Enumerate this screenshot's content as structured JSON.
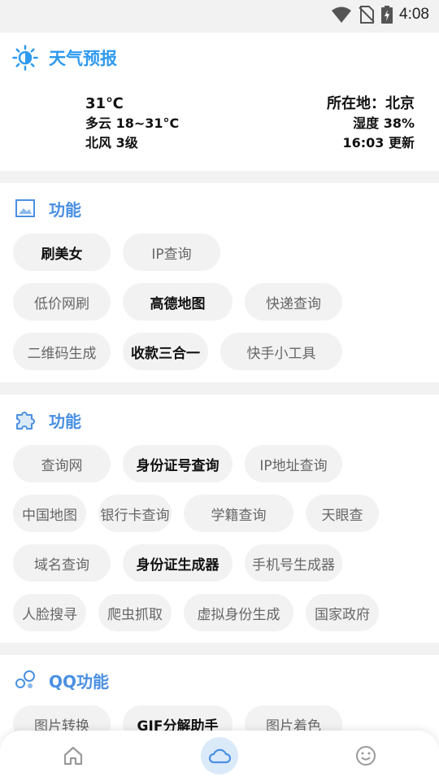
{
  "status_bar": {
    "time": "4:08"
  },
  "weather": {
    "title": "天气预报",
    "temperature": "31℃",
    "condition": "多云 18~31°C",
    "wind": "北风 3级",
    "location": "所在地：北京",
    "humidity": "湿度 38%",
    "updated": "16:03 更新"
  },
  "section1": {
    "title": "功能",
    "items": [
      {
        "label": "刷美女",
        "bold": true
      },
      {
        "label": "IP查询",
        "bold": false
      },
      {
        "label": "低价网刷",
        "bold": false
      },
      {
        "label": "高德地图",
        "bold": true
      },
      {
        "label": "快递查询",
        "bold": false
      },
      {
        "label": "二维码生成",
        "bold": false
      },
      {
        "label": "收款三合一",
        "bold": true
      },
      {
        "label": "快手小工具",
        "bold": false
      }
    ]
  },
  "section2": {
    "title": "功能",
    "items": [
      {
        "label": "查询网",
        "bold": false
      },
      {
        "label": "身份证号查询",
        "bold": true
      },
      {
        "label": "IP地址查询",
        "bold": false
      },
      {
        "label": "中国地图",
        "bold": false
      },
      {
        "label": "银行卡查询",
        "bold": false
      },
      {
        "label": "学籍查询",
        "bold": false
      },
      {
        "label": "天眼查",
        "bold": false
      },
      {
        "label": "域名查询",
        "bold": false
      },
      {
        "label": "身份证生成器",
        "bold": true
      },
      {
        "label": "手机号生成器",
        "bold": false
      },
      {
        "label": "人脸搜寻",
        "bold": false
      },
      {
        "label": "爬虫抓取",
        "bold": false
      },
      {
        "label": "虚拟身份生成",
        "bold": false
      },
      {
        "label": "国家政府",
        "bold": false
      }
    ]
  },
  "section3": {
    "title": "QQ功能",
    "items": [
      {
        "label": "图片转换",
        "bold": false
      },
      {
        "label": "GIF分解助手",
        "bold": true
      },
      {
        "label": "图片着色",
        "bold": false
      }
    ]
  },
  "nav": {
    "active": "weather",
    "items": [
      "home-icon",
      "cloud-icon",
      "smiley-icon"
    ]
  },
  "colors": {
    "accent": "#4a90e2",
    "weather_accent": "#2f9af0",
    "chip_bg": "#f2f2f2",
    "nav_active_bg": "#dbeaf9"
  }
}
